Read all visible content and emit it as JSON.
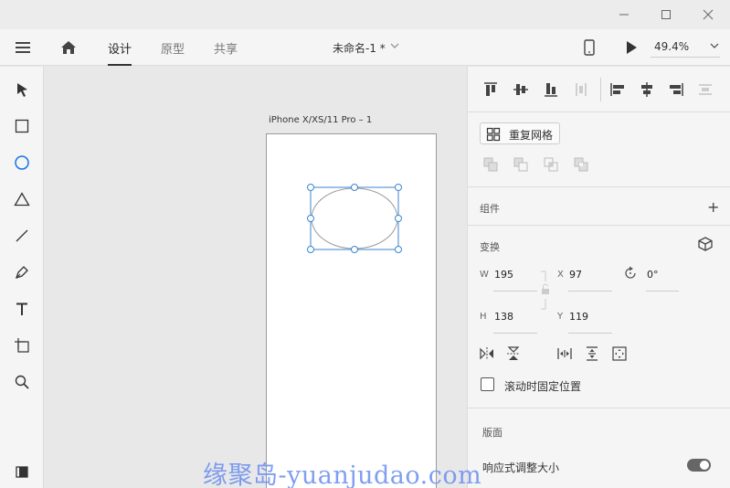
{
  "window": {
    "controls": [
      "minimize-icon",
      "maximize-icon",
      "close-icon"
    ]
  },
  "menubar": {
    "tabs": [
      {
        "label": "设计",
        "active": true
      },
      {
        "label": "原型",
        "active": false
      },
      {
        "label": "共享",
        "active": false
      }
    ],
    "document_name": "未命名-1 *",
    "zoom": "49.4%"
  },
  "toolbar": {
    "tools": [
      "select-icon",
      "rectangle-icon",
      "ellipse-icon",
      "triangle-icon",
      "line-icon",
      "pen-icon",
      "text-icon",
      "artboard-icon",
      "zoom-icon",
      "plugins-icon"
    ],
    "active_tool": "ellipse-icon"
  },
  "canvas": {
    "artboard_name": "iPhone X/XS/11 Pro – 1"
  },
  "panel": {
    "repeat_grid_label": "重复网格",
    "components_title": "组件",
    "transform_title": "变换",
    "w_label": "W",
    "w_value": "195",
    "x_label": "X",
    "x_value": "97",
    "rotation_value": "0°",
    "h_label": "H",
    "h_value": "138",
    "y_label": "Y",
    "y_value": "119",
    "fixed_scroll_label": "滚动时固定位置",
    "layout_title": "版面",
    "responsive_label": "响应式调整大小"
  },
  "watermark": "缘聚岛-yuanjudao.com",
  "colors": {
    "accent": "#1473e6",
    "selection": "#3a86d1"
  }
}
